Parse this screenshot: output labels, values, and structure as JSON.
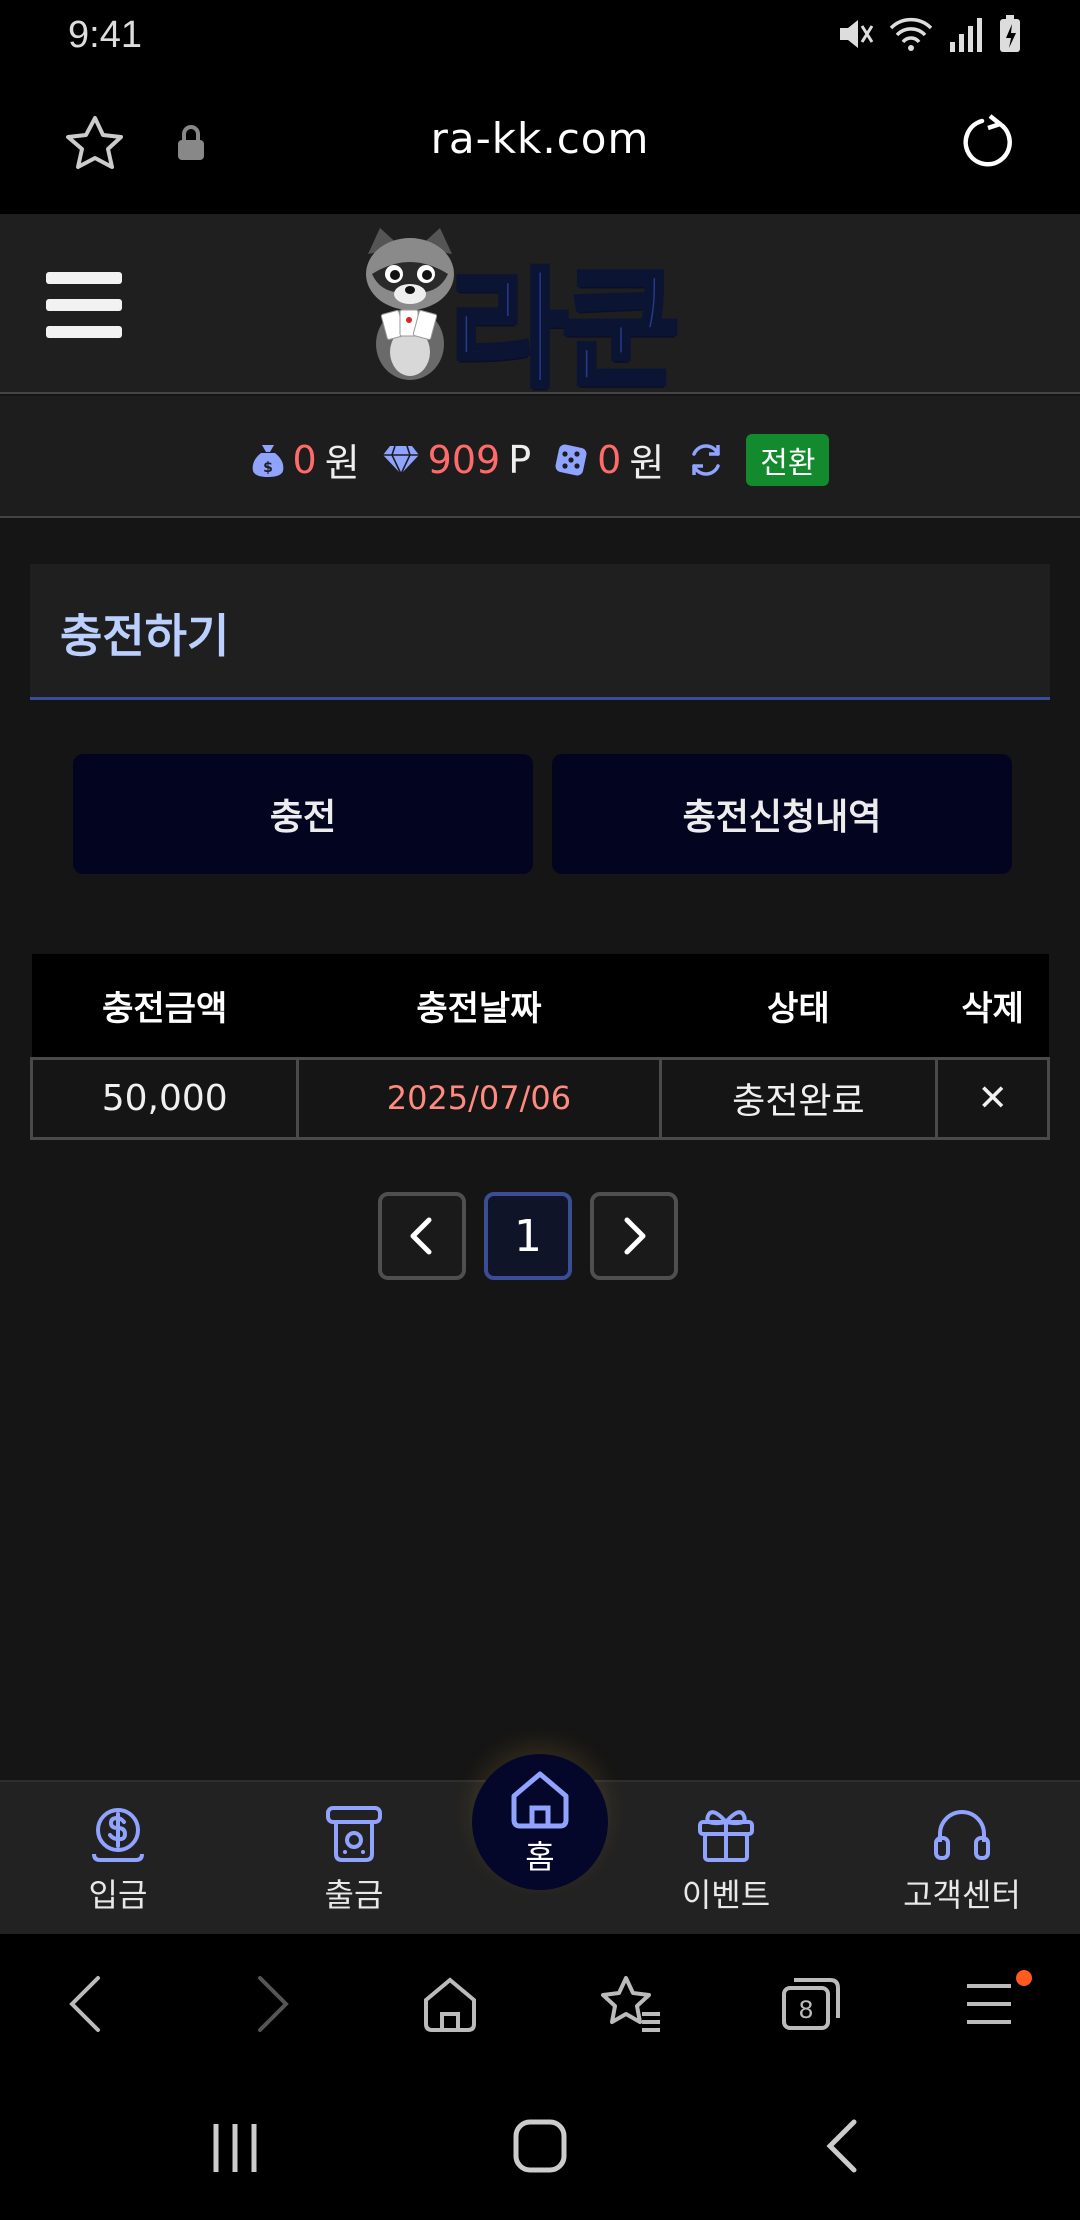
{
  "status": {
    "time": "9:41"
  },
  "browser": {
    "url": "ra-kk.com"
  },
  "header": {
    "logo_text": "라쿤"
  },
  "balance": {
    "money_value": "0",
    "money_unit": "원",
    "point_value": "909",
    "point_unit": "P",
    "casino_value": "0",
    "casino_unit": "원",
    "swap_label": "전환"
  },
  "section": {
    "title": "충전하기"
  },
  "tabs": {
    "charge": "충전",
    "history": "충전신청내역"
  },
  "table": {
    "headers": [
      "충전금액",
      "충전날짜",
      "상태",
      "삭제"
    ],
    "rows": [
      {
        "amount": "50,000",
        "date": "2025/07/06",
        "status": "충전완료",
        "delete": "✕"
      }
    ]
  },
  "pager": {
    "current": "1"
  },
  "bottom_nav": {
    "deposit": "입금",
    "withdraw": "출금",
    "home": "홈",
    "event": "이벤트",
    "support": "고객센터"
  },
  "colors": {
    "accent_red": "#ff6b6b",
    "nav_icon": "#8fa3ff",
    "swap_green": "#128a2d",
    "title_blue": "#bcd0ff"
  }
}
